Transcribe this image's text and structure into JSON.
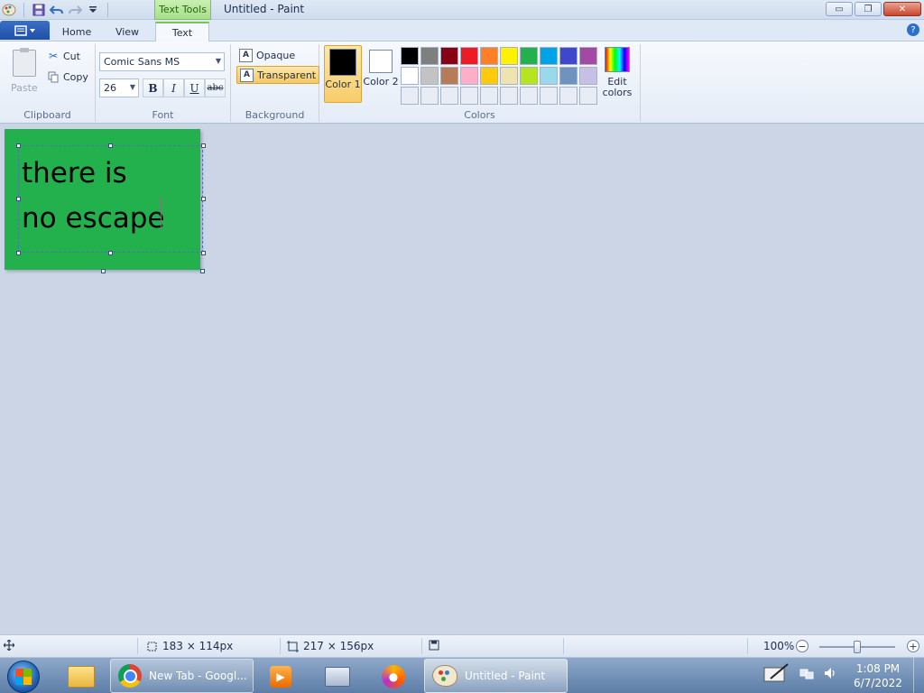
{
  "window": {
    "title": "Untitled - Paint",
    "context_tab": "Text Tools",
    "controls": {
      "minimize": "▭",
      "restore": "❐",
      "close": "✕"
    }
  },
  "qat": {
    "save_icon": "save-icon",
    "undo_icon": "undo-icon",
    "redo_icon": "redo-icon",
    "customize_icon": "dropdown-arrow-icon"
  },
  "tabs": [
    {
      "label": "Home"
    },
    {
      "label": "View"
    },
    {
      "label": "Text",
      "active": true
    }
  ],
  "help_label": "?",
  "clipboard": {
    "paste": "Paste",
    "cut": "Cut",
    "copy": "Copy",
    "label": "Clipboard"
  },
  "font": {
    "name": "Comic Sans MS",
    "size": "26",
    "bold": "B",
    "italic": "I",
    "underline": "U",
    "strike": "abc",
    "label": "Font"
  },
  "background": {
    "opaque": "Opaque",
    "transparent": "Transparent",
    "selected": "transparent",
    "label": "Background"
  },
  "colors": {
    "color1_label": "Color 1",
    "color2_label": "Color 2",
    "color1": "#000000",
    "color2": "#ffffff",
    "edit_label": "Edit colors",
    "label": "Colors",
    "palette": [
      "#000000",
      "#7f7f7f",
      "#880015",
      "#ed1c24",
      "#ff7f27",
      "#fff200",
      "#22b14c",
      "#00a2e8",
      "#3f48cc",
      "#a349a4",
      "#ffffff",
      "#c3c3c3",
      "#b97a57",
      "#ffaec9",
      "#ffc90e",
      "#efe4b0",
      "#b5e61d",
      "#99d9ea",
      "#7092be",
      "#c8bfe7",
      "#e8edf5",
      "#e8edf5",
      "#e8edf5",
      "#e8edf5",
      "#e8edf5",
      "#e8edf5",
      "#e8edf5",
      "#e8edf5",
      "#e8edf5",
      "#e8edf5"
    ]
  },
  "canvas": {
    "background_color": "#22b14c",
    "text": "there is\nno escape"
  },
  "status": {
    "selection_size": "183 × 114px",
    "canvas_size": "217 × 156px",
    "zoom": "100%",
    "zoom_minus": "−",
    "zoom_plus": "+"
  },
  "taskbar": {
    "chrome_label": "New Tab - Googl...",
    "paint_label": "Untitled - Paint",
    "time": "1:08 PM",
    "date": "6/7/2022"
  }
}
